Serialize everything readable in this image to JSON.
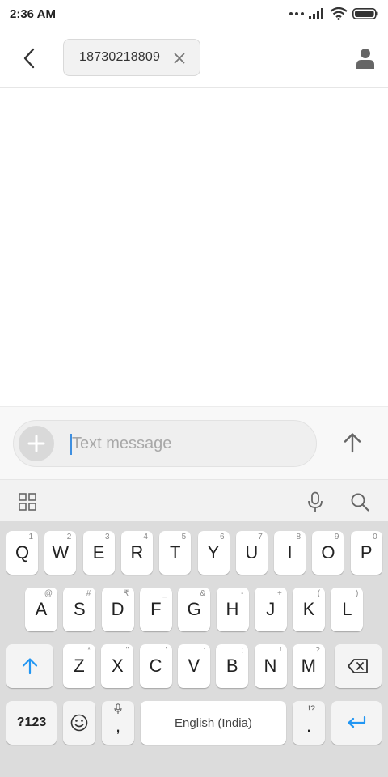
{
  "status_bar": {
    "time": "2:36 AM"
  },
  "header": {
    "recipient": "18730218809",
    "icons": {
      "back": "back-arrow-icon",
      "remove": "close-icon",
      "contact": "person-icon"
    }
  },
  "compose": {
    "placeholder": "Text message",
    "value": "",
    "icons": {
      "attach": "plus-icon",
      "send": "arrow-up-icon"
    }
  },
  "keyboard_toolbar": {
    "icons": [
      "grid-icon",
      "microphone-icon",
      "search-icon"
    ]
  },
  "keyboard": {
    "row1": [
      {
        "label": "Q",
        "hint": "1"
      },
      {
        "label": "W",
        "hint": "2"
      },
      {
        "label": "E",
        "hint": "3"
      },
      {
        "label": "R",
        "hint": "4"
      },
      {
        "label": "T",
        "hint": "5"
      },
      {
        "label": "Y",
        "hint": "6"
      },
      {
        "label": "U",
        "hint": "7"
      },
      {
        "label": "I",
        "hint": "8"
      },
      {
        "label": "O",
        "hint": "9"
      },
      {
        "label": "P",
        "hint": "0"
      }
    ],
    "row2": [
      {
        "label": "A",
        "hint": "@"
      },
      {
        "label": "S",
        "hint": "#"
      },
      {
        "label": "D",
        "hint": "₹"
      },
      {
        "label": "F",
        "hint": "_"
      },
      {
        "label": "G",
        "hint": "&"
      },
      {
        "label": "H",
        "hint": "-"
      },
      {
        "label": "J",
        "hint": "+"
      },
      {
        "label": "K",
        "hint": "("
      },
      {
        "label": "L",
        "hint": ")"
      }
    ],
    "row3": [
      {
        "label": "Z",
        "hint": "*"
      },
      {
        "label": "X",
        "hint": "\""
      },
      {
        "label": "C",
        "hint": "'"
      },
      {
        "label": "V",
        "hint": ":"
      },
      {
        "label": "B",
        "hint": ";"
      },
      {
        "label": "N",
        "hint": "!"
      },
      {
        "label": "M",
        "hint": "?"
      }
    ],
    "symbols_label": "?123",
    "comma_label": ",",
    "space_label": "English (India)",
    "period_label": ".",
    "period_hint": "!?",
    "accent_color": "#2196f3"
  }
}
